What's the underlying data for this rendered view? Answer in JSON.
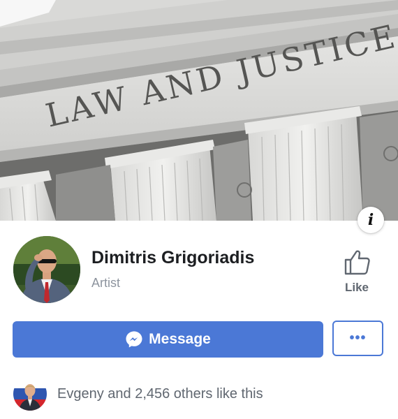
{
  "cover": {
    "engraving": "LAW AND JUSTICE",
    "info_glyph": "i"
  },
  "profile": {
    "name": "Dimitris Grigoriadis",
    "category": "Artist",
    "like_label": "Like"
  },
  "actions": {
    "message_label": "Message",
    "more_label": "•••"
  },
  "social": {
    "likes_text": "Evgeny and 2,456 others like this"
  },
  "colors": {
    "accent": "#4b78d6",
    "secondary_text": "#606770",
    "muted_text": "#8d949e"
  },
  "icons": [
    "info-icon",
    "thumbs-up-icon",
    "messenger-icon",
    "more-dots-icon"
  ]
}
